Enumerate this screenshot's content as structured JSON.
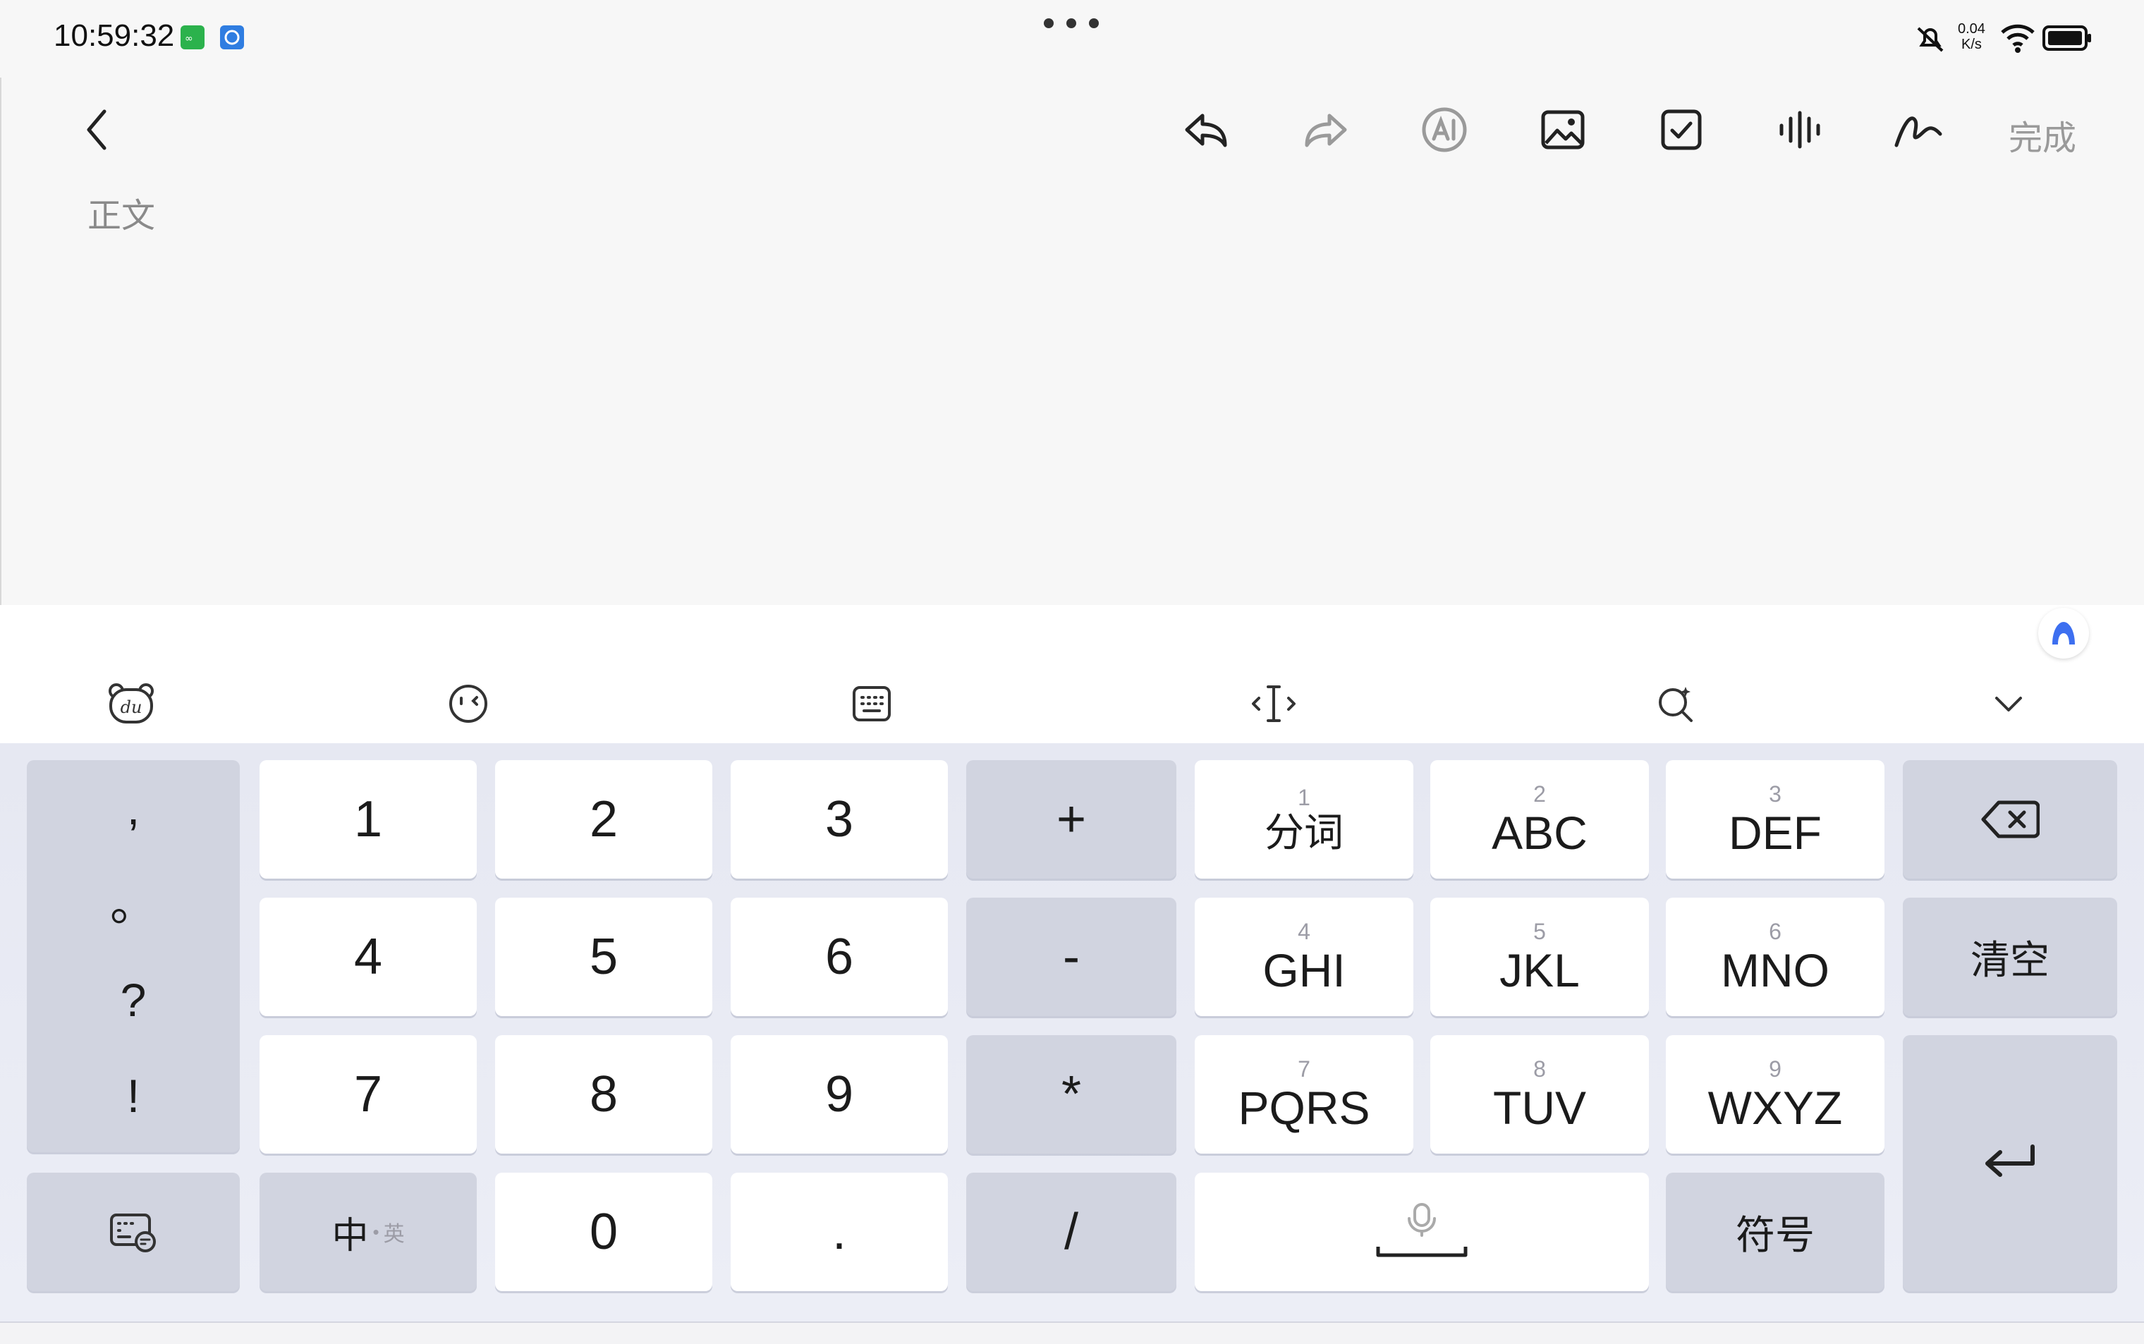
{
  "status_bar": {
    "time": "10:59:32",
    "net_speed_value": "0.04",
    "net_speed_unit": "K/s",
    "app_icons": [
      "green-app-icon",
      "blue-app-icon"
    ],
    "right_icons": [
      "mute-bell-icon",
      "wifi-icon",
      "battery-icon"
    ]
  },
  "editor": {
    "toolbar_icons": [
      "undo-icon",
      "redo-icon",
      "ai-icon",
      "image-icon",
      "checkbox-icon",
      "voice-icon",
      "handwriting-icon"
    ],
    "done_label": "完成",
    "body_placeholder": "正文"
  },
  "keyboard": {
    "toolbar_icons": [
      "du-bear-icon",
      "emoji-icon",
      "keyboard-layout-icon",
      "cursor-move-icon",
      "search-icon",
      "collapse-chevron-icon"
    ],
    "punctuation": [
      ",",
      "。",
      "?",
      "!"
    ],
    "digits": [
      "1",
      "2",
      "3",
      "4",
      "5",
      "6",
      "7",
      "8",
      "9",
      "0",
      "."
    ],
    "operators": [
      "+",
      "-",
      "*",
      "/"
    ],
    "t9": [
      {
        "num": "1",
        "label": "分词"
      },
      {
        "num": "2",
        "label": "ABC"
      },
      {
        "num": "3",
        "label": "DEF"
      },
      {
        "num": "4",
        "label": "GHI"
      },
      {
        "num": "5",
        "label": "JKL"
      },
      {
        "num": "6",
        "label": "MNO"
      },
      {
        "num": "7",
        "label": "PQRS"
      },
      {
        "num": "8",
        "label": "TUV"
      },
      {
        "num": "9",
        "label": "WXYZ"
      }
    ],
    "clear_label": "清空",
    "lang_label_main": "中",
    "lang_label_sub": "英",
    "symbols_label": "符号",
    "colors": {
      "key_white": "#ffffff",
      "key_gray": "#d1d4e0",
      "accent": "#3d6ff0"
    }
  }
}
